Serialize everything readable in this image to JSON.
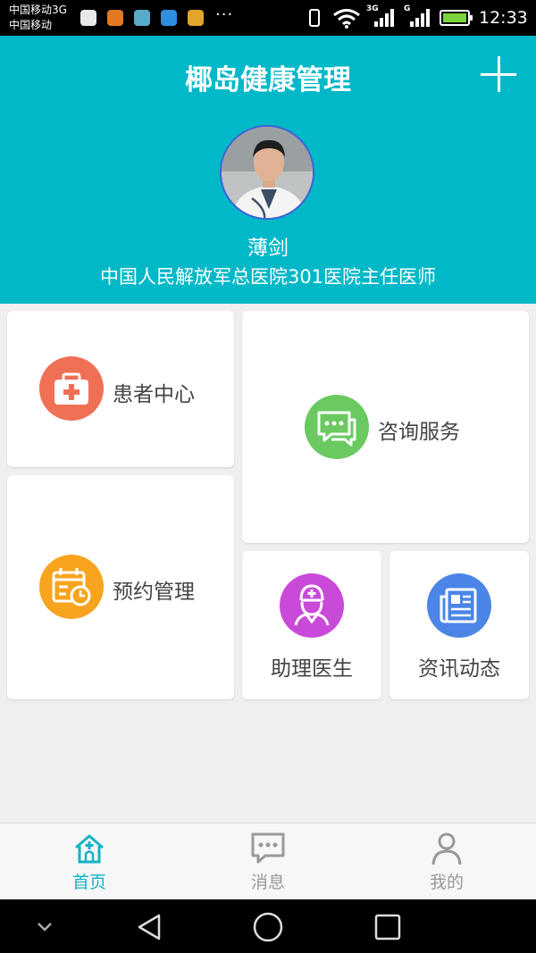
{
  "status_bar": {
    "carrier_line1": "中国移动3G",
    "carrier_line2": "中国移动",
    "more": "···",
    "net_3g": "3G",
    "net_g": "G",
    "time": "12:33"
  },
  "header": {
    "title": "椰岛健康管理",
    "doctor_name": "薄剑",
    "doctor_title": "中国人民解放军总医院301医院主任医师"
  },
  "tiles": {
    "patient_center": "患者中心",
    "consult_service": "咨询服务",
    "appointment": "预约管理",
    "assistant_doctor": "助理医生",
    "news": "资讯动态"
  },
  "bottom_nav": {
    "home": "首页",
    "messages": "消息",
    "mine": "我的",
    "active": "home"
  },
  "colors": {
    "brand": "#00b8c8",
    "active_tab": "#14b3c5",
    "patient": "#f07056",
    "consult": "#6bc961",
    "appointment": "#f8a41e",
    "assistant": "#c94ad8",
    "news": "#4b86e6"
  }
}
